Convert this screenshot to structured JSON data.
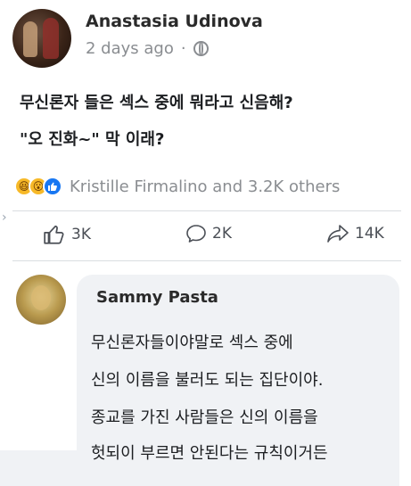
{
  "post": {
    "author": "Anastasia Udinova",
    "timestamp": "2 days ago",
    "separator": "·",
    "lines": [
      "무신론자 들은 섹스 중에 뭐라고 신음해?",
      "\"오 진화~\" 막 이래?"
    ],
    "reactions_text": "Kristille Firmalino and 3.2K others",
    "reaction_icons": [
      "haha-icon",
      "wow-icon",
      "like-icon"
    ],
    "actions": {
      "like_count": "3K",
      "comment_count": "2K",
      "share_count": "14K"
    }
  },
  "comment": {
    "author": "Sammy Pasta",
    "lines": [
      "무신론자들이야말로 섹스 중에",
      "신의 이름을 불러도 되는 집단이야.",
      "종교를 가진 사람들은 신의 이름을",
      "헛되이 부르면 안된다는 규칙이거든"
    ]
  },
  "colors": {
    "like_blue": "#1877f2",
    "haha_yellow": "#f7b928",
    "muted_text": "#8a8d91",
    "bubble_bg": "#f0f2f5"
  }
}
